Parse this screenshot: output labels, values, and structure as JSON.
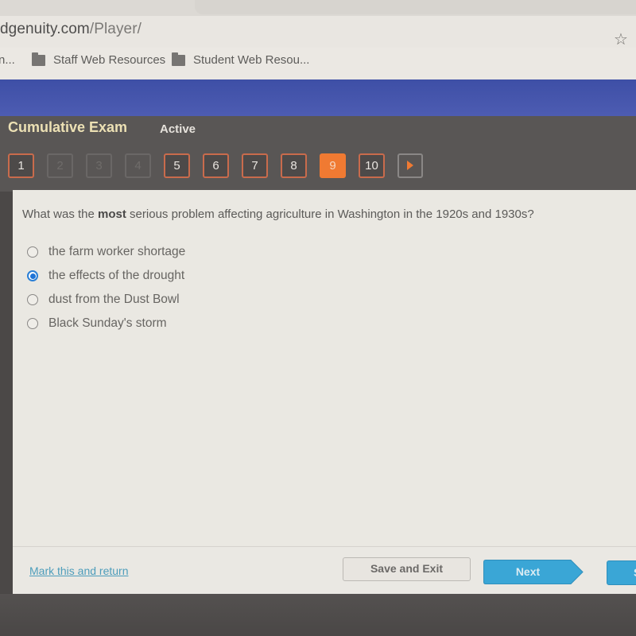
{
  "browser": {
    "url_host": "dgenuity.com",
    "url_path": "/Player/",
    "bookmark_icon": "star-icon",
    "bookmarks": [
      {
        "label": "n...",
        "icon": "none"
      },
      {
        "label": "Staff Web Resources",
        "icon": "folder-icon"
      },
      {
        "label": "Student Web Resou...",
        "icon": "folder-icon"
      }
    ]
  },
  "exam": {
    "title": "Cumulative Exam",
    "status": "Active",
    "questions": [
      {
        "label": "1",
        "state": "answered"
      },
      {
        "label": "2",
        "state": "disabled"
      },
      {
        "label": "3",
        "state": "disabled"
      },
      {
        "label": "4",
        "state": "disabled"
      },
      {
        "label": "5",
        "state": "answered"
      },
      {
        "label": "6",
        "state": "answered"
      },
      {
        "label": "7",
        "state": "answered"
      },
      {
        "label": "8",
        "state": "answered"
      },
      {
        "label": "9",
        "state": "current"
      },
      {
        "label": "10",
        "state": "answered"
      }
    ],
    "next_arrow_icon": "play-arrow-icon"
  },
  "question": {
    "text_before": "What was the ",
    "text_bold": "most",
    "text_after": " serious problem affecting agriculture in Washington in the 1920s and 1930s?",
    "options": [
      {
        "label": "the farm worker shortage",
        "selected": false
      },
      {
        "label": "the effects of the drought",
        "selected": true
      },
      {
        "label": "dust from the Dust Bowl",
        "selected": false
      },
      {
        "label": "Black Sunday's storm",
        "selected": false
      }
    ]
  },
  "footer": {
    "mark_link": "Mark this and return",
    "save_exit": "Save and Exit",
    "next": "Next",
    "submit": "S"
  },
  "colors": {
    "banner": "#4454ac",
    "accent_orange": "#f07a32",
    "radio_selected": "#1f74d6",
    "next_button": "#3aa6d6",
    "link": "#4d9dbb"
  }
}
